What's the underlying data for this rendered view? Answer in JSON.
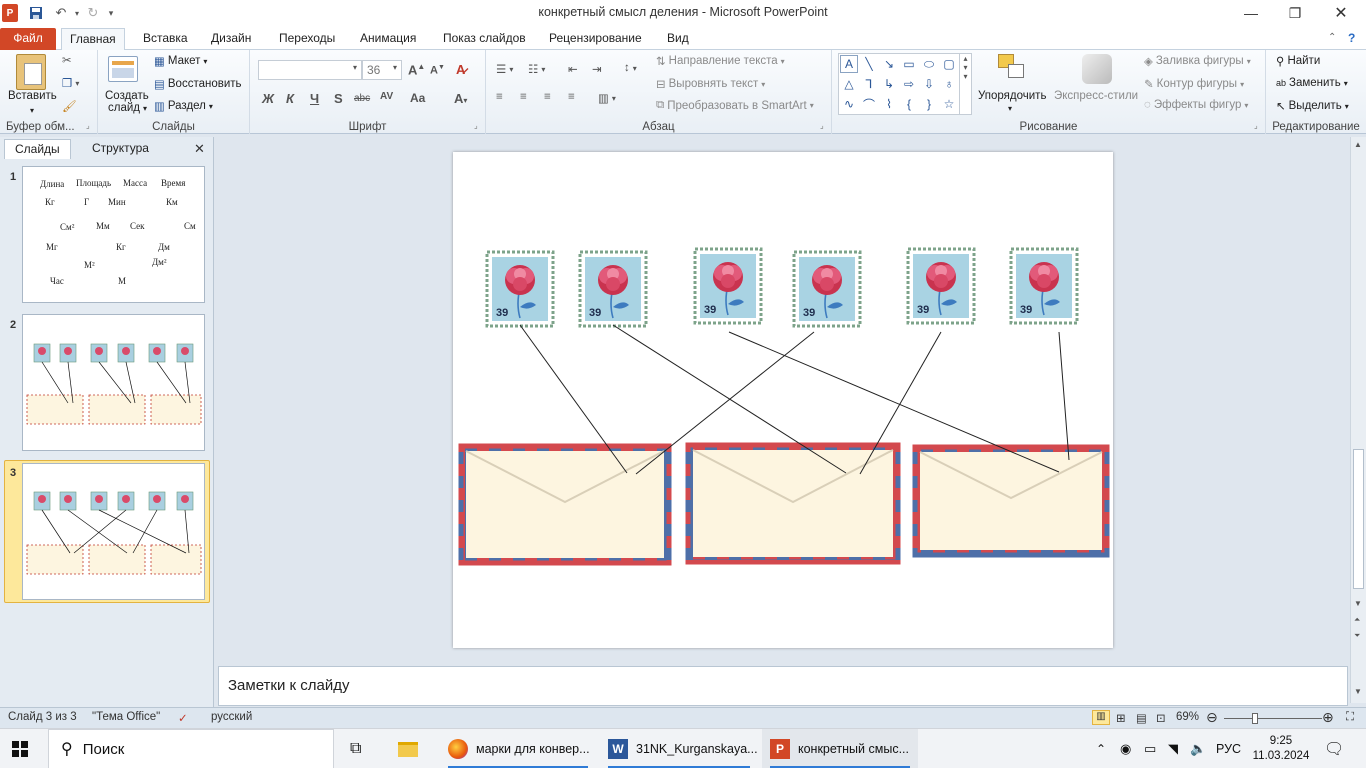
{
  "window": {
    "title": "конкретный смысл деления - Microsoft PowerPoint",
    "app_letter": "P"
  },
  "ribbon_tabs": [
    "Файл",
    "Главная",
    "Вставка",
    "Дизайн",
    "Переходы",
    "Анимация",
    "Показ слайдов",
    "Рецензирование",
    "Вид"
  ],
  "clipboard": {
    "paste": "Вставить",
    "group": "Буфер обм..."
  },
  "slides_group": {
    "new_slide_1": "Создать",
    "new_slide_2": "слайд",
    "layout": "Макет",
    "reset": "Восстановить",
    "section": "Раздел",
    "group": "Слайды"
  },
  "font_group": {
    "font_size": "36",
    "group": "Шрифт",
    "bold": "Ж",
    "italic": "К",
    "underline": "Ч",
    "shadow": "S",
    "strike": "abc",
    "spacing": "AV",
    "case": "Aa"
  },
  "paragraph_group": {
    "text_direction": "Направление текста",
    "align_text": "Выровнять текст",
    "smartart": "Преобразовать в SmartArt",
    "group": "Абзац"
  },
  "drawing_group": {
    "arrange": "Упорядочить",
    "quick_styles": "Экспресс-стили",
    "fill": "Заливка фигуры",
    "outline": "Контур фигуры",
    "effects": "Эффекты фигур",
    "group": "Рисование"
  },
  "editing_group": {
    "find": "Найти",
    "replace": "Заменить",
    "select": "Выделить",
    "group": "Редактирование"
  },
  "left_pane": {
    "tabs": [
      "Слайды",
      "Структура"
    ],
    "slide1_words": [
      {
        "t": "Длина"
      },
      {
        "t": "Площадь"
      },
      {
        "t": "Масса"
      },
      {
        "t": "Время"
      },
      {
        "t": "Кг"
      },
      {
        "t": "Г"
      },
      {
        "t": "Мин"
      },
      {
        "t": "Км"
      },
      {
        "t": "См²"
      },
      {
        "t": "Мм"
      },
      {
        "t": "Сек"
      },
      {
        "t": "См"
      },
      {
        "t": "Мг"
      },
      {
        "t": "Кг"
      },
      {
        "t": "Дм"
      },
      {
        "t": "М²"
      },
      {
        "t": "Дм²"
      },
      {
        "t": "Час"
      },
      {
        "t": "М"
      }
    ]
  },
  "slide": {
    "stamp_price": "39",
    "stamp_count": 6,
    "envelope_count": 3
  },
  "notes": {
    "placeholder": "Заметки к слайду"
  },
  "statusbar": {
    "slide_info": "Слайд 3 из 3",
    "theme": "\"Тема Office\"",
    "language": "русский",
    "zoom": "69%"
  },
  "taskbar": {
    "search": "Поиск",
    "apps": [
      {
        "label": "марки для конвер..."
      },
      {
        "label": "31NK_Kurganskaya..."
      },
      {
        "label": "конкретный смыс..."
      }
    ],
    "lang": "РУС",
    "time": "9:25",
    "date": "11.03.2024"
  },
  "colors": {
    "file_tab": "#d24726",
    "accent": "#2b5797",
    "selected_thumb": "#fde89b"
  }
}
